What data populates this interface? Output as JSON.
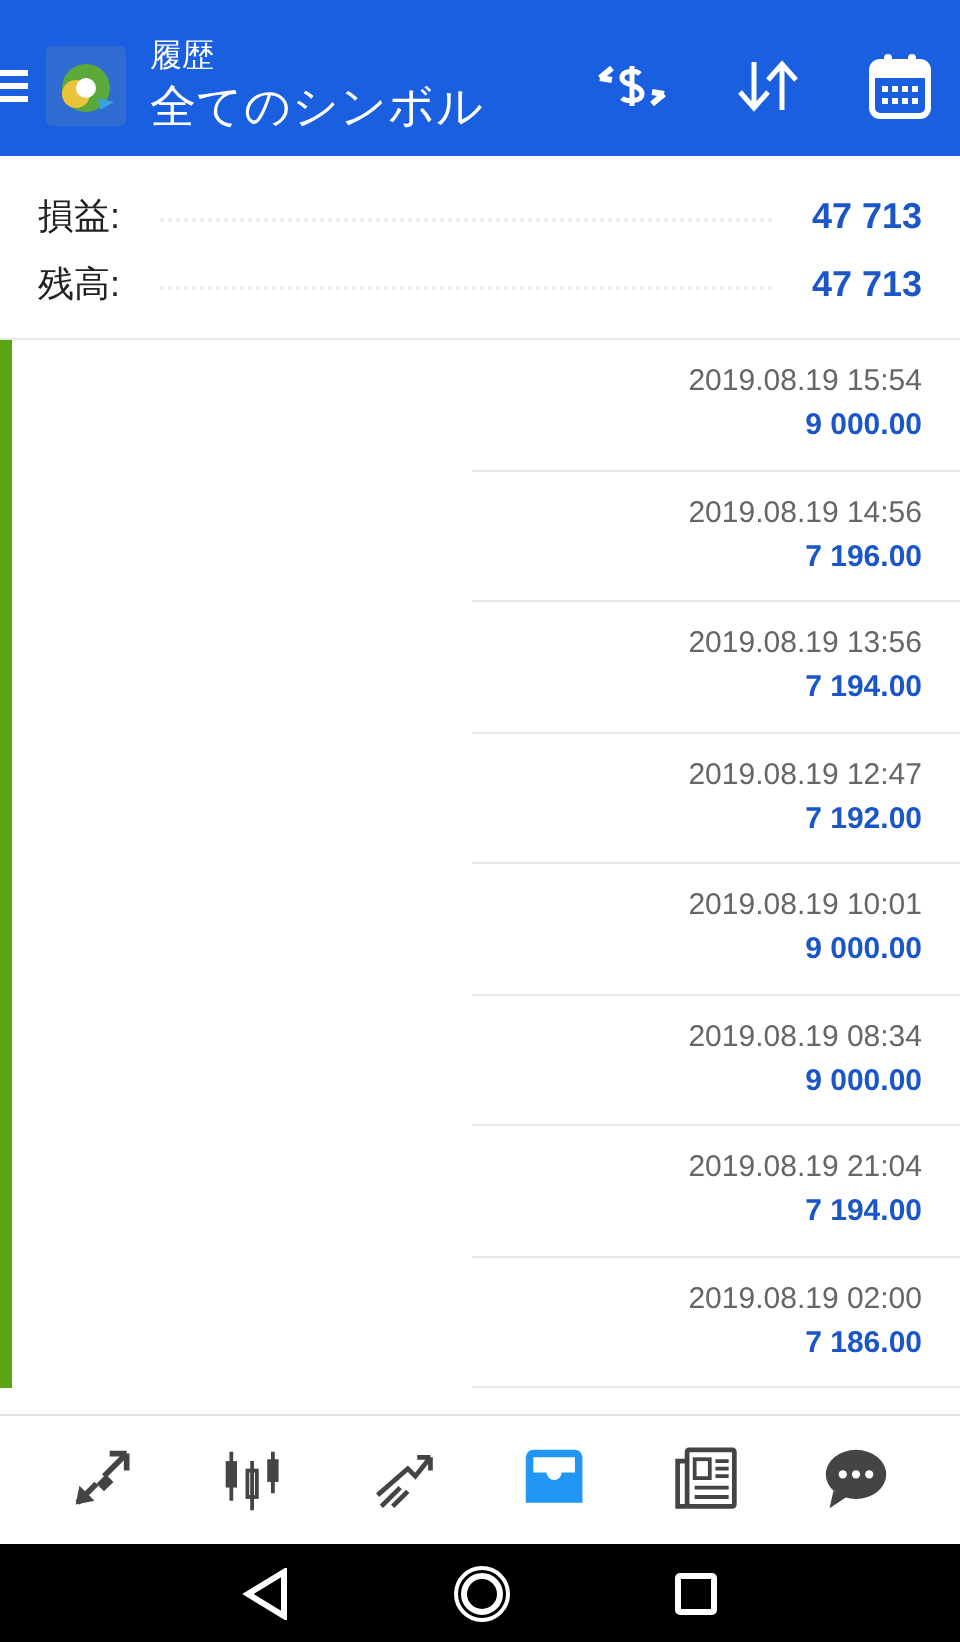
{
  "app_bar": {
    "title": "履歴",
    "subtitle": "全てのシンボル"
  },
  "summary": [
    {
      "label": "損益:",
      "value": "47 713"
    },
    {
      "label": "残高:",
      "value": "47 713"
    }
  ],
  "deals": [
    {
      "time": "2019.08.19 15:54",
      "amount": "9 000.00",
      "color": "#5ba414"
    },
    {
      "time": "2019.08.19 14:56",
      "amount": "7 196.00",
      "color": "#5ba414"
    },
    {
      "time": "2019.08.19 13:56",
      "amount": "7 194.00",
      "color": "#5ba414"
    },
    {
      "time": "2019.08.19 12:47",
      "amount": "7 192.00",
      "color": "#5ba414"
    },
    {
      "time": "2019.08.19 10:01",
      "amount": "9 000.00",
      "color": "#5ba414"
    },
    {
      "time": "2019.08.19 08:34",
      "amount": "9 000.00",
      "color": "#5ba414"
    },
    {
      "time": "2019.08.19 21:04",
      "amount": "7 194.00",
      "color": "#5ba414"
    },
    {
      "time": "2019.08.19 02:00",
      "amount": "7 186.00",
      "color": "#5ba414"
    }
  ],
  "bottom_nav": [
    {
      "kind": "quotes",
      "selected": false
    },
    {
      "kind": "chart",
      "selected": false
    },
    {
      "kind": "trade",
      "selected": false
    },
    {
      "kind": "history",
      "selected": true
    },
    {
      "kind": "news",
      "selected": false
    },
    {
      "kind": "chat",
      "selected": false
    }
  ]
}
